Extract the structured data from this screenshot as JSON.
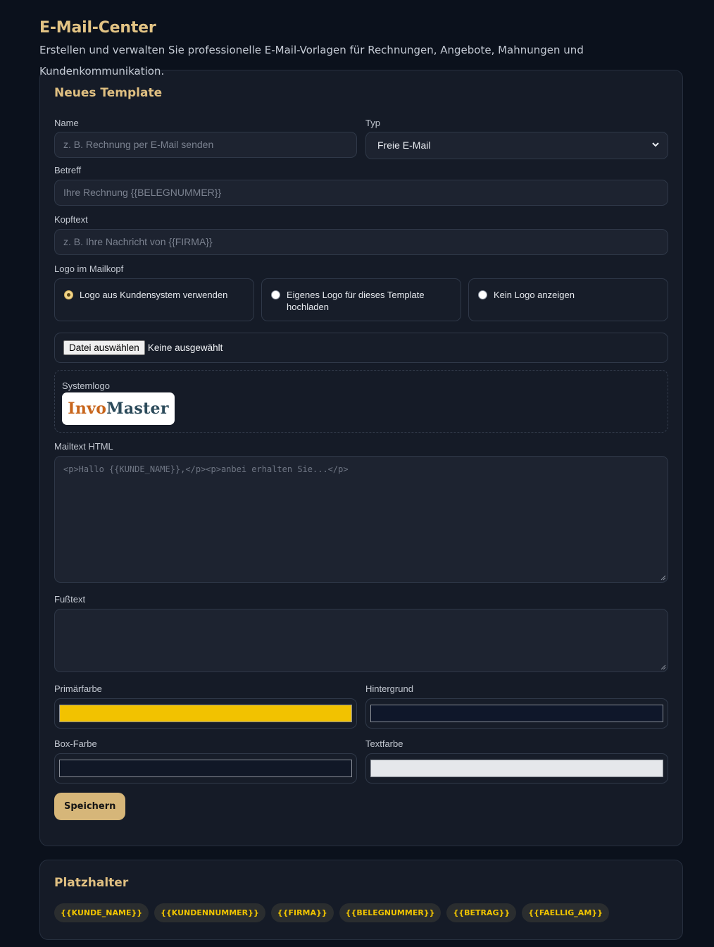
{
  "header": {
    "title": "E-Mail-Center",
    "subtitle": "Erstellen und verwalten Sie professionelle E-Mail-Vorlagen für Rechnungen, Angebote, Mahnungen und Kundenkommunikation."
  },
  "template_form": {
    "title": "Neues Template",
    "name": {
      "label": "Name",
      "value": "",
      "placeholder": "z. B. Rechnung per E-Mail senden"
    },
    "type": {
      "label": "Typ",
      "selected": "Freie E-Mail"
    },
    "subject": {
      "label": "Betreff",
      "value": "",
      "placeholder": "Ihre Rechnung {{BELEGNUMMER}}"
    },
    "header_text": {
      "label": "Kopftext",
      "value": "",
      "placeholder": "z. B. Ihre Nachricht von {{FIRMA}}"
    },
    "logo": {
      "label": "Logo im Mailkopf",
      "options": [
        {
          "label": "Logo aus Kundensystem verwenden",
          "checked": true
        },
        {
          "label": "Eigenes Logo für dieses Template hochladen",
          "checked": false
        },
        {
          "label": "Kein Logo anzeigen",
          "checked": false
        }
      ]
    },
    "file": {
      "button_label": "Datei auswählen",
      "status": "Keine ausgewählt"
    },
    "system_logo": {
      "label": "Systemlogo",
      "logo_text_1": "Invo",
      "logo_text_2": "Master"
    },
    "mail_html": {
      "label": "Mailtext HTML",
      "value": "",
      "placeholder": "<p>Hallo {{KUNDE_NAME}},</p><p>anbei erhalten Sie...</p>"
    },
    "footer_text": {
      "label": "Fußtext",
      "value": "",
      "placeholder": ""
    },
    "colors": {
      "primary": {
        "label": "Primärfarbe",
        "value": "#f2c200"
      },
      "background": {
        "label": "Hintergrund",
        "value": "#0f172a"
      },
      "box": {
        "label": "Box-Farbe",
        "value": "#111827"
      },
      "text": {
        "label": "Textfarbe",
        "value": "#e5e7eb"
      }
    },
    "save_label": "Speichern"
  },
  "placeholders": {
    "title": "Platzhalter",
    "items": [
      "{{KUNDE_NAME}}",
      "{{KUNDENNUMMER}}",
      "{{FIRMA}}",
      "{{BELEGNUMMER}}",
      "{{BETRAG}}",
      "{{FAELLIG_AM}}"
    ]
  }
}
